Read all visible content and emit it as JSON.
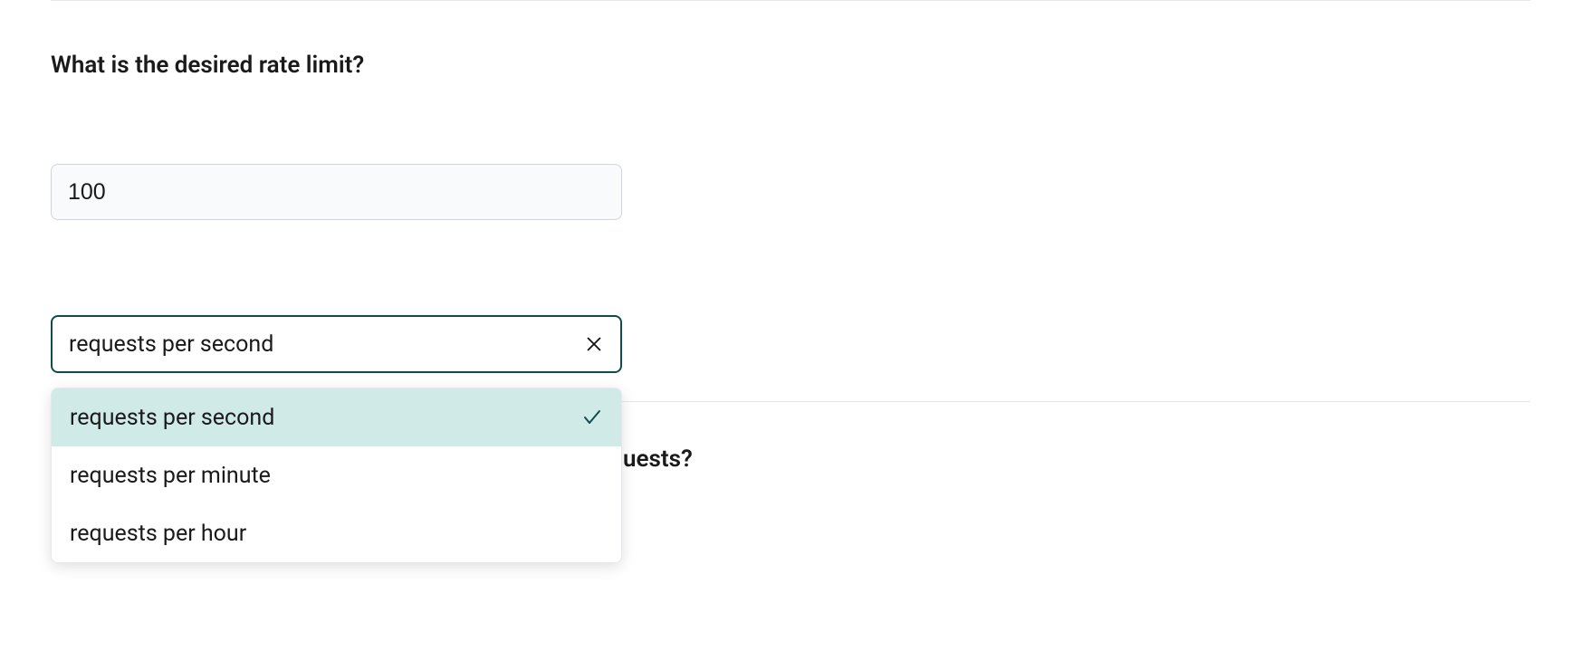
{
  "form": {
    "rate_limit_question": "What is the desired rate limit?",
    "rate_limit_value": "100",
    "unit_selection": {
      "value": "requests per second",
      "options": [
        {
          "label": "requests per second",
          "selected": true
        },
        {
          "label": "requests per minute",
          "selected": false
        },
        {
          "label": "requests per hour",
          "selected": false
        }
      ]
    },
    "next_question_fragment": "uests?"
  }
}
